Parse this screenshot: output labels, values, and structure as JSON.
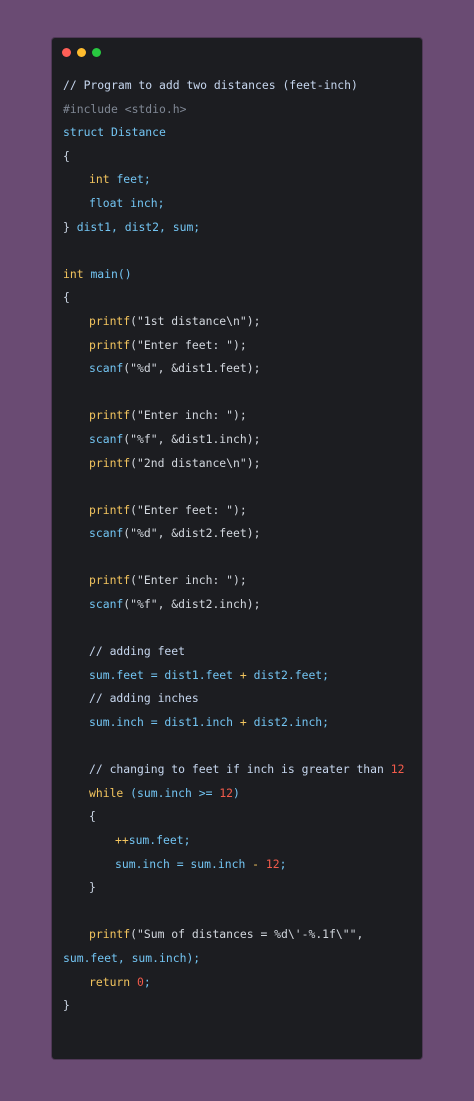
{
  "window": {
    "traffic_lights": [
      "close",
      "minimize",
      "maximize"
    ]
  },
  "code": {
    "lines": [
      {
        "segments": [
          {
            "t": "// Program to add two distances (feet-inch)",
            "k": "comment"
          }
        ],
        "indent": 0
      },
      {
        "segments": [
          {
            "t": "#include <stdio.h>",
            "k": "pp"
          }
        ],
        "indent": 0
      },
      {
        "segments": [
          {
            "t": "struct ",
            "k": "kw"
          },
          {
            "t": "Distance",
            "k": "kw"
          }
        ],
        "indent": 0
      },
      {
        "segments": [
          {
            "t": "{",
            "k": "var"
          }
        ],
        "indent": 0
      },
      {
        "segments": [
          {
            "t": "int ",
            "k": "type"
          },
          {
            "t": "feet;",
            "k": "kw"
          }
        ],
        "indent": 1
      },
      {
        "segments": [
          {
            "t": "float ",
            "k": "kw"
          },
          {
            "t": "inch;",
            "k": "kw"
          }
        ],
        "indent": 1
      },
      {
        "segments": [
          {
            "t": "} ",
            "k": "var"
          },
          {
            "t": "dist1, dist2, sum;",
            "k": "kw"
          }
        ],
        "indent": 0
      },
      {
        "segments": [
          {
            "t": "",
            "k": "var"
          }
        ],
        "indent": 0
      },
      {
        "segments": [
          {
            "t": "int ",
            "k": "type"
          },
          {
            "t": "main()",
            "k": "kw"
          }
        ],
        "indent": 0
      },
      {
        "segments": [
          {
            "t": "{",
            "k": "var"
          }
        ],
        "indent": 0
      },
      {
        "segments": [
          {
            "t": "printf",
            "k": "fn"
          },
          {
            "t": "(\"1st distance\\n\");",
            "k": "str"
          }
        ],
        "indent": 1
      },
      {
        "segments": [
          {
            "t": "printf",
            "k": "fn"
          },
          {
            "t": "(\"Enter feet: \");",
            "k": "str"
          }
        ],
        "indent": 1
      },
      {
        "segments": [
          {
            "t": "scanf",
            "k": "kw"
          },
          {
            "t": "(\"%d\", &dist1.feet);",
            "k": "str"
          }
        ],
        "indent": 1
      },
      {
        "segments": [
          {
            "t": "",
            "k": "var"
          }
        ],
        "indent": 0
      },
      {
        "segments": [
          {
            "t": "printf",
            "k": "fn"
          },
          {
            "t": "(\"Enter inch: \");",
            "k": "str"
          }
        ],
        "indent": 1
      },
      {
        "segments": [
          {
            "t": "scanf",
            "k": "kw"
          },
          {
            "t": "(\"%f\", &dist1.inch);",
            "k": "str"
          }
        ],
        "indent": 1
      },
      {
        "segments": [
          {
            "t": "printf",
            "k": "fn"
          },
          {
            "t": "(\"2nd distance\\n\");",
            "k": "str"
          }
        ],
        "indent": 1
      },
      {
        "segments": [
          {
            "t": "",
            "k": "var"
          }
        ],
        "indent": 0
      },
      {
        "segments": [
          {
            "t": "printf",
            "k": "fn"
          },
          {
            "t": "(\"Enter feet: \");",
            "k": "str"
          }
        ],
        "indent": 1
      },
      {
        "segments": [
          {
            "t": "scanf",
            "k": "kw"
          },
          {
            "t": "(\"%d\", &dist2.feet);",
            "k": "str"
          }
        ],
        "indent": 1
      },
      {
        "segments": [
          {
            "t": "",
            "k": "var"
          }
        ],
        "indent": 0
      },
      {
        "segments": [
          {
            "t": "printf",
            "k": "fn"
          },
          {
            "t": "(\"Enter inch: \");",
            "k": "str"
          }
        ],
        "indent": 1
      },
      {
        "segments": [
          {
            "t": "scanf",
            "k": "kw"
          },
          {
            "t": "(\"%f\", &dist2.inch);",
            "k": "str"
          }
        ],
        "indent": 1
      },
      {
        "segments": [
          {
            "t": "",
            "k": "var"
          }
        ],
        "indent": 0
      },
      {
        "segments": [
          {
            "t": "// adding feet",
            "k": "comment"
          }
        ],
        "indent": 1
      },
      {
        "segments": [
          {
            "t": "sum.feet = dist1.feet ",
            "k": "kw"
          },
          {
            "t": "+",
            "k": "op"
          },
          {
            "t": " dist2.feet;",
            "k": "kw"
          }
        ],
        "indent": 1
      },
      {
        "segments": [
          {
            "t": "// adding inches",
            "k": "comment"
          }
        ],
        "indent": 1
      },
      {
        "segments": [
          {
            "t": "sum.inch = dist1.inch ",
            "k": "kw"
          },
          {
            "t": "+",
            "k": "op"
          },
          {
            "t": " dist2.inch;",
            "k": "kw"
          }
        ],
        "indent": 1
      },
      {
        "segments": [
          {
            "t": "",
            "k": "var"
          }
        ],
        "indent": 0
      },
      {
        "segments": [
          {
            "t": "// changing to feet if inch is greater than ",
            "k": "comment"
          },
          {
            "t": "12",
            "k": "num"
          }
        ],
        "indent": 1
      },
      {
        "segments": [
          {
            "t": "while ",
            "k": "type"
          },
          {
            "t": "(sum.inch >= ",
            "k": "kw"
          },
          {
            "t": "12",
            "k": "num"
          },
          {
            "t": ")",
            "k": "kw"
          }
        ],
        "indent": 1
      },
      {
        "segments": [
          {
            "t": "{",
            "k": "var"
          }
        ],
        "indent": 1
      },
      {
        "segments": [
          {
            "t": "++",
            "k": "op"
          },
          {
            "t": "sum.feet;",
            "k": "kw"
          }
        ],
        "indent": 2
      },
      {
        "segments": [
          {
            "t": "sum.inch = sum.inch ",
            "k": "kw"
          },
          {
            "t": "- ",
            "k": "op"
          },
          {
            "t": "12",
            "k": "num"
          },
          {
            "t": ";",
            "k": "kw"
          }
        ],
        "indent": 2
      },
      {
        "segments": [
          {
            "t": "}",
            "k": "var"
          }
        ],
        "indent": 1
      },
      {
        "segments": [
          {
            "t": "",
            "k": "var"
          }
        ],
        "indent": 0
      },
      {
        "segments": [
          {
            "t": "printf",
            "k": "fn"
          },
          {
            "t": "(\"Sum of distances = %d\\'-%.1f\\\"\",",
            "k": "str"
          }
        ],
        "indent": 1
      },
      {
        "segments": [
          {
            "t": "sum.feet, sum.inch);",
            "k": "kw"
          }
        ],
        "indent": 0
      },
      {
        "segments": [
          {
            "t": "return ",
            "k": "type"
          },
          {
            "t": "0",
            "k": "num"
          },
          {
            "t": ";",
            "k": "kw"
          }
        ],
        "indent": 1
      },
      {
        "segments": [
          {
            "t": "}",
            "k": "var"
          }
        ],
        "indent": 0
      }
    ]
  }
}
